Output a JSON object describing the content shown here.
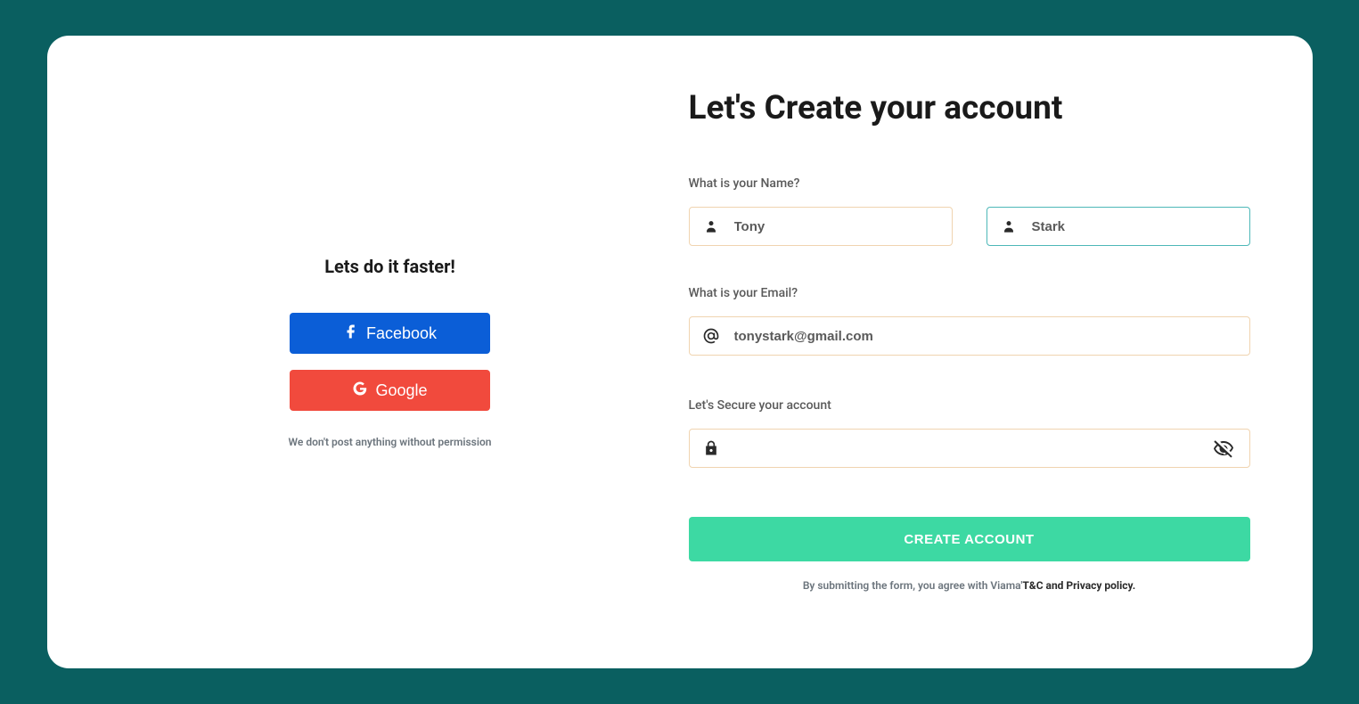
{
  "left": {
    "title": "Lets do it faster!",
    "facebook_label": "Facebook",
    "google_label": "Google",
    "disclaimer": "We don't post anything without permission"
  },
  "right": {
    "heading": "Let's Create your account",
    "name_label": "What is your Name?",
    "first_name_value": "Tony",
    "last_name_value": "Stark",
    "email_label": "What is your Email?",
    "email_value": "tonystark@gmail.com",
    "password_label": "Let's Secure your account",
    "password_value": "",
    "submit_label": "CREATE ACCOUNT",
    "terms_prefix": "By submitting the form, you agree with Viama'",
    "terms_bold": "T&C and Privacy policy."
  }
}
